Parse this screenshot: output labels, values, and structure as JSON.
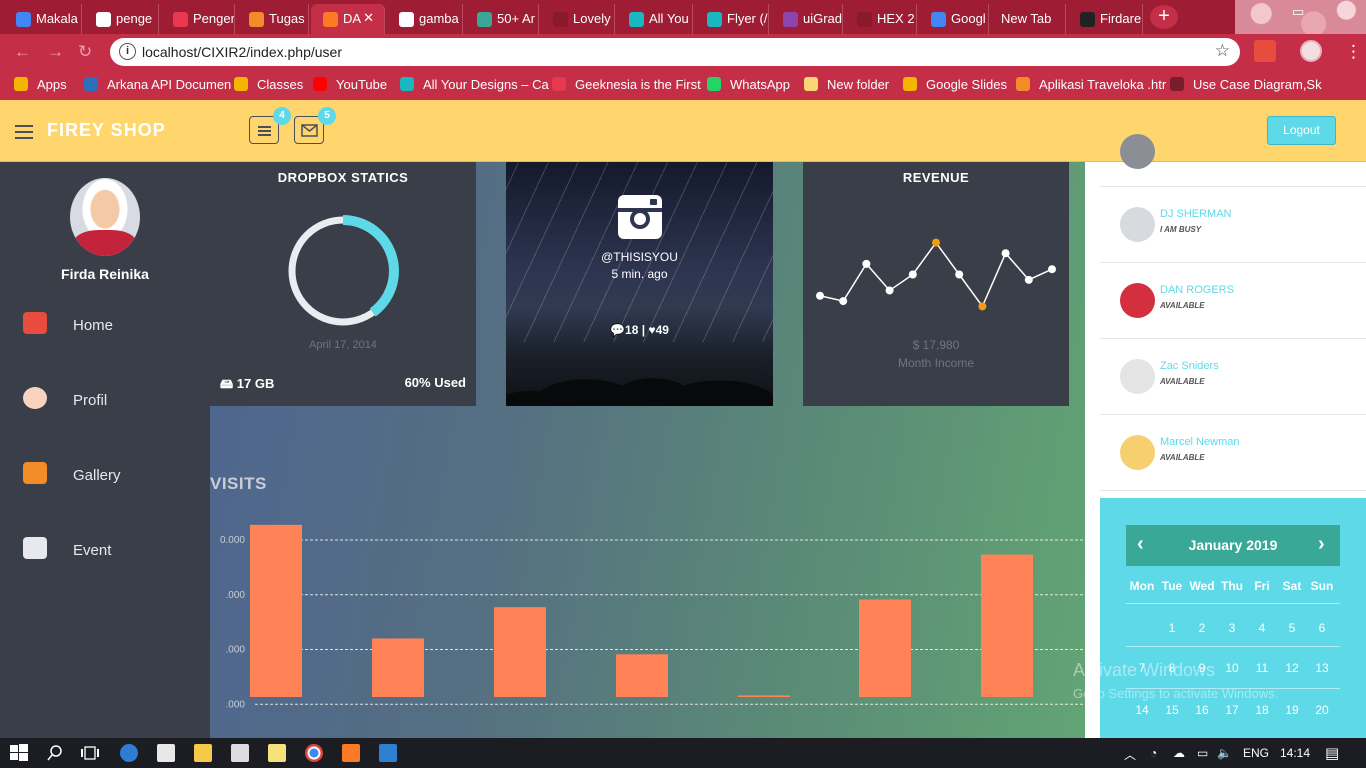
{
  "browser": {
    "tabs": [
      {
        "label": "Makala",
        "color": "#4285f4"
      },
      {
        "label": "penge",
        "color": "#ffffff"
      },
      {
        "label": "Penger",
        "color": "#e8384f"
      },
      {
        "label": "Tugas",
        "color": "#f28c28"
      },
      {
        "label": "DA",
        "color": "#fb7a24",
        "active": true
      },
      {
        "label": "gamba",
        "color": "#ffffff"
      },
      {
        "label": "50+ Ar",
        "color": "#3aa896"
      },
      {
        "label": "Lovely",
        "color": "#8a1a2a"
      },
      {
        "label": "All You",
        "color": "#1ab7c1"
      },
      {
        "label": "Flyer (/",
        "color": "#1ab7c1"
      },
      {
        "label": "uiGrad",
        "color": "#8e44ad"
      },
      {
        "label": "HEX 2",
        "color": "#8a1a2a"
      },
      {
        "label": "Googl",
        "color": "#4285f4"
      },
      {
        "label": "New Tab",
        "color": ""
      },
      {
        "label": "Firdare",
        "color": "#222222"
      }
    ],
    "tab_close": "✕",
    "new_tab": "+",
    "url": "localhost/CIXIR2/index.php/user",
    "bookmarks": [
      {
        "label": "Apps",
        "color": "#f4b400"
      },
      {
        "label": "Arkana API Documen",
        "color": "#2c6fbb"
      },
      {
        "label": "Classes",
        "color": "#f4b400"
      },
      {
        "label": "YouTube",
        "color": "#ff0000"
      },
      {
        "label": "All Your Designs – Ca",
        "color": "#1ab7c1"
      },
      {
        "label": "Geeknesia is the First",
        "color": "#e8384f"
      },
      {
        "label": "WhatsApp",
        "color": "#25d366"
      },
      {
        "label": "New folder",
        "color": "#f7d774"
      },
      {
        "label": "Google Slides",
        "color": "#f4b400"
      },
      {
        "label": "Aplikasi Traveloka .htr",
        "color": "#f28c28"
      },
      {
        "label": "Use Case Diagram,Sk",
        "color": "#7a1c2a"
      }
    ]
  },
  "header": {
    "brand": "FIREY SHOP",
    "tasks_badge": "4",
    "mail_badge": "5",
    "logout": "Logout"
  },
  "sidebar": {
    "user_name": "Firda Reinika",
    "items": [
      {
        "label": "Home",
        "icon": "home-icon",
        "color": "#e74c3c"
      },
      {
        "label": "Profil",
        "icon": "profile-icon",
        "color": "#f7d3c0"
      },
      {
        "label": "Gallery",
        "icon": "gallery-icon",
        "color": "#f28c28"
      },
      {
        "label": "Event",
        "icon": "calendar-icon",
        "color": "#e8e9ee"
      }
    ]
  },
  "dropbox": {
    "title": "DROPBOX STATICS",
    "date": "April 17, 2014",
    "storage": "17 GB",
    "used": "60% Used",
    "used_fraction": 0.4
  },
  "instagram": {
    "handle": "@THISISYOU",
    "time": "5 min. ago",
    "comments": "18",
    "separator": "|",
    "likes": "49"
  },
  "revenue": {
    "title": "REVENUE",
    "amount": "$ 17,980",
    "subtitle": "Month Income"
  },
  "visits": {
    "title": "VISITS",
    "ytick_labels": [
      ".000",
      ".000",
      ".000",
      "0.000"
    ]
  },
  "contacts": [
    {
      "name": "DJ SHERMAN",
      "status": "I AM BUSY",
      "avatar_color": "#d7dade"
    },
    {
      "name": "DAN ROGERS",
      "status": "AVAILABLE",
      "avatar_color": "#d32f3f"
    },
    {
      "name": "Zac Sniders",
      "status": "AVAILABLE",
      "avatar_color": "#e4e4e4"
    },
    {
      "name": "Marcel Newman",
      "status": "AVAILABLE",
      "avatar_color": "#f6cf6e"
    }
  ],
  "calendar": {
    "month": "January 2019",
    "weekdays": [
      "Mon",
      "Tue",
      "Wed",
      "Thu",
      "Fri",
      "Sat",
      "Sun"
    ],
    "week1": [
      "1",
      "2",
      "3",
      "4",
      "5",
      "6"
    ],
    "week2": [
      "7",
      "8",
      "9",
      "10",
      "11",
      "12",
      "13"
    ],
    "week3": [
      "14",
      "15",
      "16",
      "17",
      "18",
      "19",
      "20"
    ]
  },
  "windows_watermark": {
    "line1": "Activate Windows",
    "line2": "Go to Settings to activate Windows."
  },
  "taskbar": {
    "lang": "ENG",
    "time": "14:14"
  },
  "chart_data": [
    {
      "type": "line",
      "title": "REVENUE",
      "values": [
        4,
        3,
        10,
        5,
        8,
        14,
        8,
        2,
        12,
        7,
        9
      ],
      "highlight_points": [
        5,
        7
      ],
      "ylim": [
        0,
        16
      ],
      "line_color": "#ffffff",
      "highlight_color": "#f39c12"
    },
    {
      "type": "bar",
      "title": "VISITS",
      "values": [
        2720,
        925,
        1420,
        675,
        25,
        1540,
        2250
      ],
      "ylim": [
        0,
        3460
      ],
      "bar_color": "#ff8356",
      "grid": true
    }
  ]
}
